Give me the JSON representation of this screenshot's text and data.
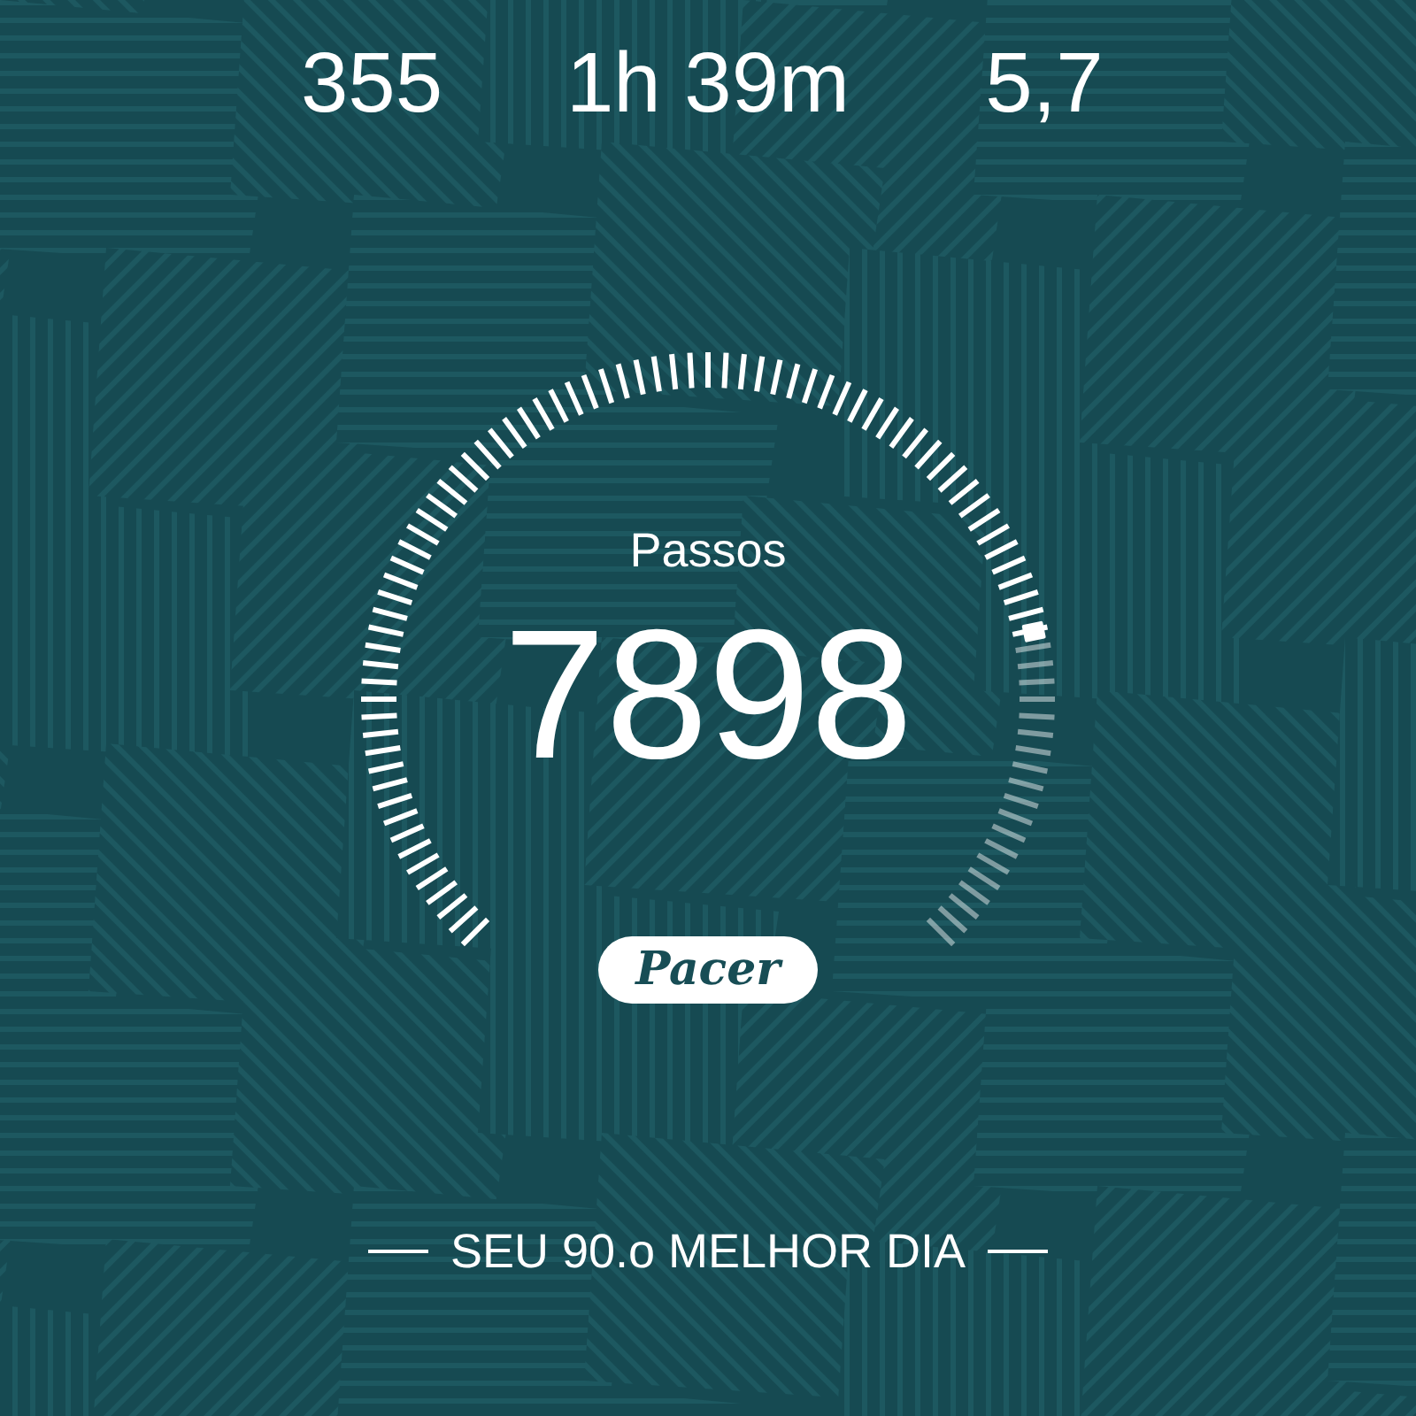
{
  "stats": [
    {
      "value": "355"
    },
    {
      "value": "1h 39m"
    },
    {
      "value": "5,7"
    }
  ],
  "steps": {
    "label": "Passos",
    "value": "7898"
  },
  "logo": "Pacer",
  "best_day": "SEU 90.o MELHOR DIA"
}
